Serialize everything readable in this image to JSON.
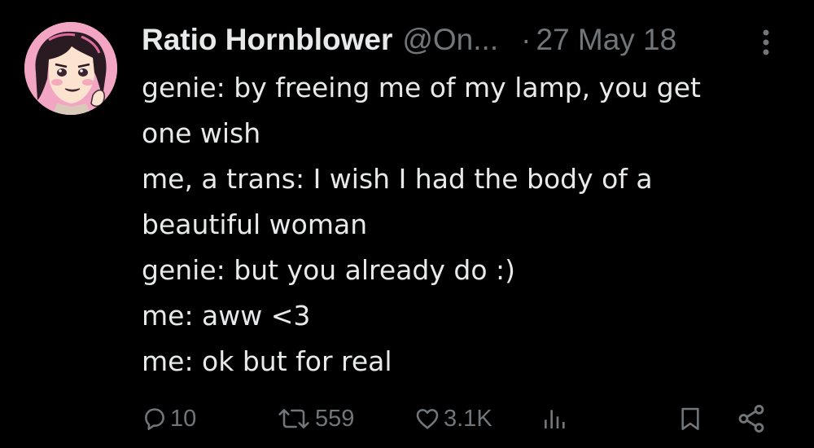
{
  "author": {
    "display_name": "Ratio Hornblower",
    "handle": "@On...",
    "separator": "·",
    "date": "27 May 18",
    "avatar_icon": "avatar-illustration"
  },
  "tweet": {
    "lines": [
      "genie: by freeing me of my lamp, you get",
      "one wish",
      "me, a trans: I wish I had the body of a",
      "beautiful woman",
      "genie: but you already do :)",
      "me: aww <3",
      "me: ok but for real"
    ]
  },
  "actions": {
    "reply": {
      "icon": "reply-icon",
      "count": "10"
    },
    "retweet": {
      "icon": "retweet-icon",
      "count": "559"
    },
    "like": {
      "icon": "heart-icon",
      "count": "3.1K"
    },
    "views": {
      "icon": "views-chart-icon"
    },
    "bookmark": {
      "icon": "bookmark-icon"
    },
    "share": {
      "icon": "share-icon"
    },
    "more": {
      "icon": "more-vertical-icon"
    }
  },
  "colors": {
    "background": "#000000",
    "text_primary": "#e7e9ea",
    "text_secondary": "#71767b",
    "avatar_bg": "#f3a5c4"
  }
}
